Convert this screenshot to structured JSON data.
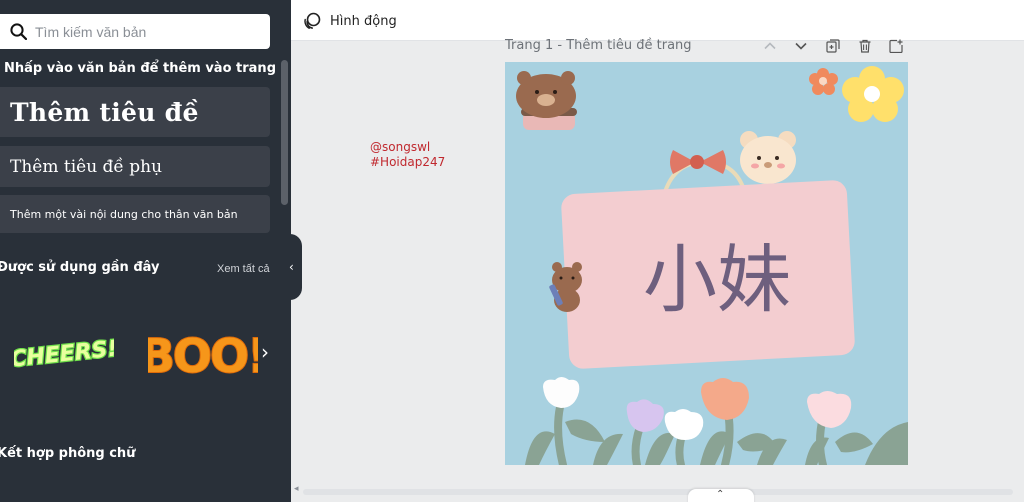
{
  "sidebar": {
    "search_placeholder": "Tìm kiếm văn bản",
    "hint": "Nhấp vào văn bản để thêm vào trang",
    "add_heading": "Thêm tiêu đề",
    "add_subheading": "Thêm tiêu đề phụ",
    "add_body": "Thêm một vài nội dung cho thân văn bản",
    "recent_title": "Được sử dụng gần đây",
    "see_all": "Xem tất cả",
    "stickers": [
      "CHEERS!",
      "BOO!"
    ],
    "font_combos_title": "Kết hợp phông chữ",
    "icons": {
      "search": "search-icon",
      "next": "chevron-right-icon",
      "collapse": "chevron-left-icon"
    }
  },
  "topbar": {
    "animate_label": "Hình động",
    "animate_icon": "animate-icon"
  },
  "page": {
    "header": "Trang 1 - Thêm tiêu đề trang",
    "tools": [
      "chevron-up-icon",
      "chevron-down-icon",
      "duplicate-page-icon",
      "delete-page-icon",
      "add-page-icon"
    ],
    "title_text": "小妹",
    "background_color": "#a8d1e0",
    "card_color": "#f3cdd0",
    "title_color": "#6e5f7e"
  },
  "credit": {
    "line1": "@songswl",
    "line2": "#Hoidap247"
  },
  "colors": {
    "sidebar_bg": "#293039",
    "sidebar_box": "#3b4049",
    "canvas_bg": "#ebeced",
    "credit": "#c0282e"
  }
}
